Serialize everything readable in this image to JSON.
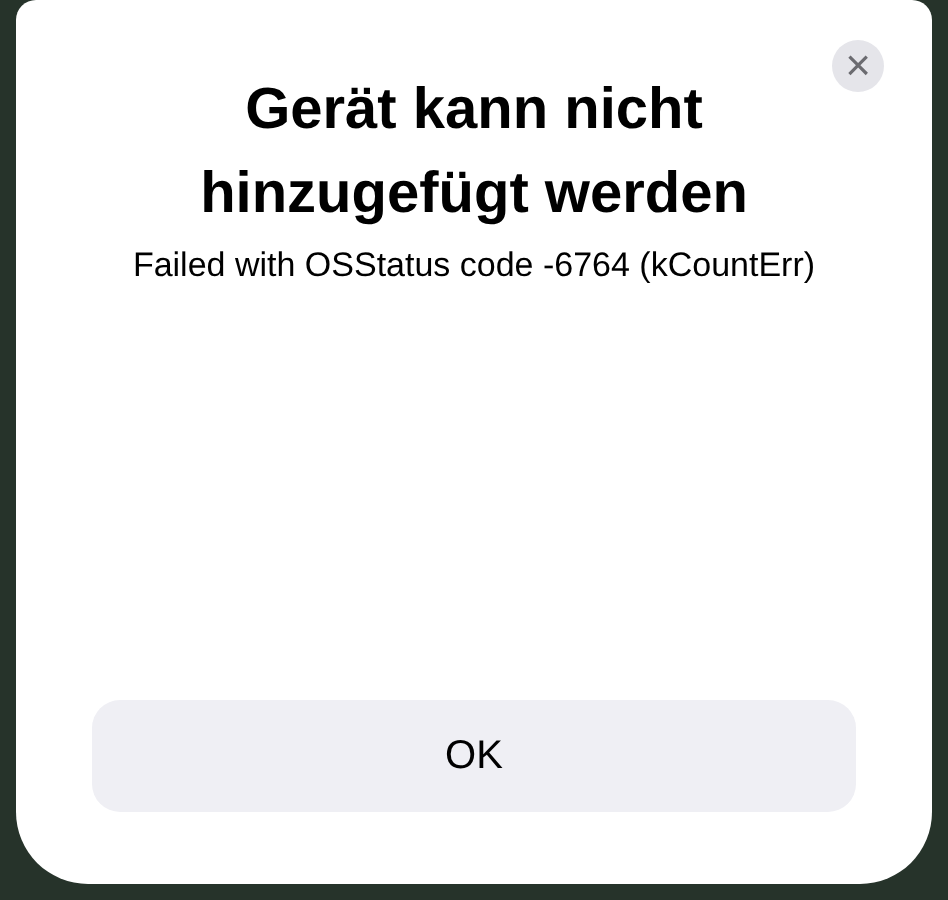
{
  "dialog": {
    "title": "Gerät kann nicht hinzugefügt werden",
    "message": "Failed with OSStatus code -6764 (kCountErr)",
    "close_button": "×",
    "buttons": [
      "OK"
    ]
  }
}
